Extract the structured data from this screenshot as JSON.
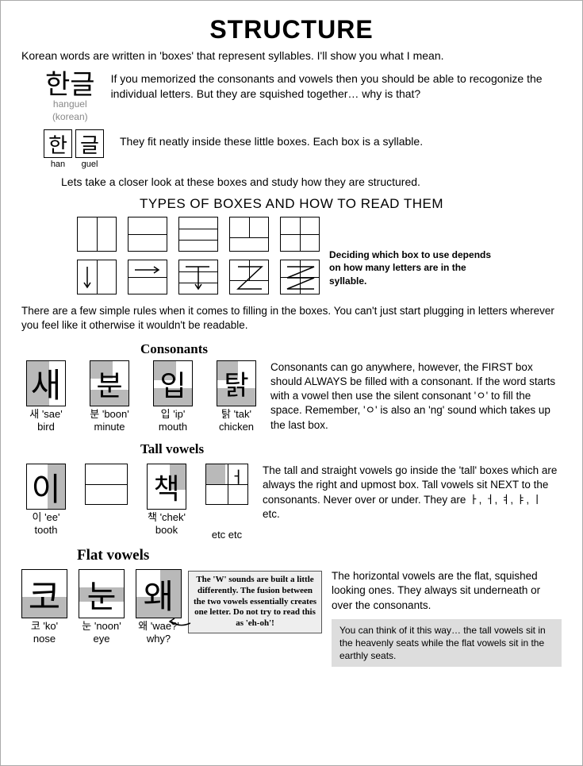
{
  "title": "STRUCTURE",
  "intro": "Korean words are written in 'boxes' that represent syllables.  I'll show you what I mean.",
  "example1": {
    "korean": "한글",
    "rom": "hanguel",
    "eng": "(korean)",
    "text": "If you memorized the consonants and vowels then you should be able to recogonize the individual letters.  But they are squished together… why is that?"
  },
  "example2": {
    "k1": "한",
    "k2": "글",
    "l1": "han",
    "l2": "guel",
    "text": "They fit neatly inside these little boxes.  Each box is a syllable."
  },
  "closer": "Lets take a closer look at these boxes and study how they are structured.",
  "types_heading": "TYPES OF BOXES AND HOW TO READ THEM",
  "side_note": "Deciding which box to use depends on how many letters are in the syllable.",
  "rules": "There are a few simple rules when it comes to filling in the boxes.  You can't just start plugging in letters wherever you feel like it otherwise it wouldn't be readable.",
  "consonants": {
    "heading": "Consonants",
    "items": [
      {
        "k": "새",
        "label": "새 'sae'",
        "eng": "bird"
      },
      {
        "k": "분",
        "label": "분 'boon'",
        "eng": "minute"
      },
      {
        "k": "입",
        "label": "입 'ip'",
        "eng": "mouth"
      },
      {
        "k": "탉",
        "label": "탉 'tak'",
        "eng": "chicken"
      }
    ],
    "explain": "Consonants can go anywhere, however, the FIRST box should ALWAYS be filled with a consonant. If the word starts with a vowel then use the silent consonant  'ㅇ' to fill the space.  Remember, 'ㅇ' is also an 'ng' sound which takes up the last box."
  },
  "tall": {
    "heading": "Tall vowels",
    "items": [
      {
        "k": "이",
        "label": "이 'ee'",
        "eng": "tooth"
      },
      {
        "k": "책",
        "label": "책 'chek'",
        "eng": "book"
      }
    ],
    "etc": "etc etc",
    "explain": "The tall and straight vowels go inside the 'tall' boxes which are always the right and upmost box.  Tall vowels sit NEXT to the consonants.  Never over or under.   They are    ㅏ, ㅓ, ㅕ, ㅑ, ㅣ   etc."
  },
  "flat": {
    "heading": "Flat vowels",
    "items": [
      {
        "k": "코",
        "label": "코 'ko'",
        "eng": "nose"
      },
      {
        "k": "눈",
        "label": "눈 'noon'",
        "eng": "eye"
      },
      {
        "k": "왜",
        "label": "왜 'wae?'",
        "eng": "why?"
      }
    ],
    "callout": "The 'W' sounds are built a little differently. The fusion between the two vowels essentially creates one letter. Do not try to read this as 'eh-oh'!",
    "explain": "The horizontal vowels are the flat, squished looking ones. They always sit underneath or over the consonants.",
    "tip": "You can think of it this way… the tall vowels sit in the heavenly seats while the flat vowels sit in the earthly seats."
  }
}
